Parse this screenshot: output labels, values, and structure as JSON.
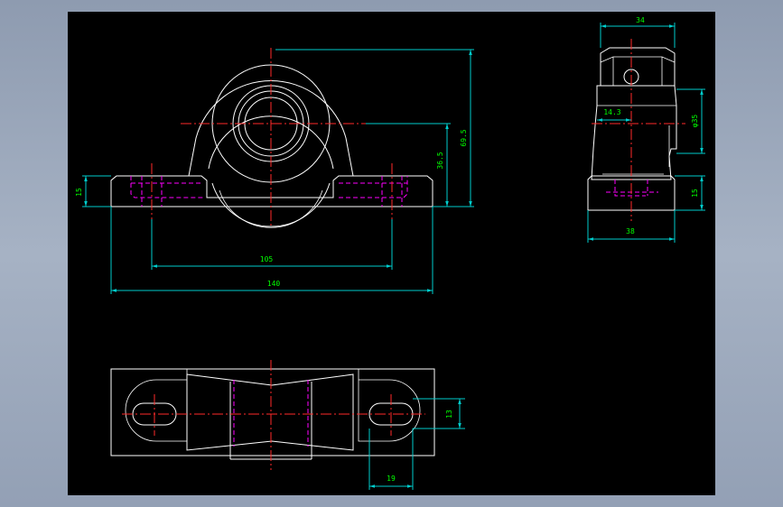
{
  "colors": {
    "background": "#000000",
    "outline": "#ffffff",
    "centerline": "#ff2a2a",
    "hidden": "#ff00ff",
    "dimension_line": "#00cccc",
    "dimension_text": "#00ff00",
    "frame": "#9aa7bb"
  },
  "dimensions": {
    "front_height_total": "69.5",
    "front_center_height": "36.5",
    "front_base_thickness": "15",
    "bolt_spacing": "105",
    "base_length": "140",
    "side_width_top": "34",
    "side_offset": "14.3",
    "side_bore": "φ35",
    "side_base_thickness": "15",
    "side_base_width": "38",
    "slot_width": "13",
    "slot_length": "19"
  }
}
